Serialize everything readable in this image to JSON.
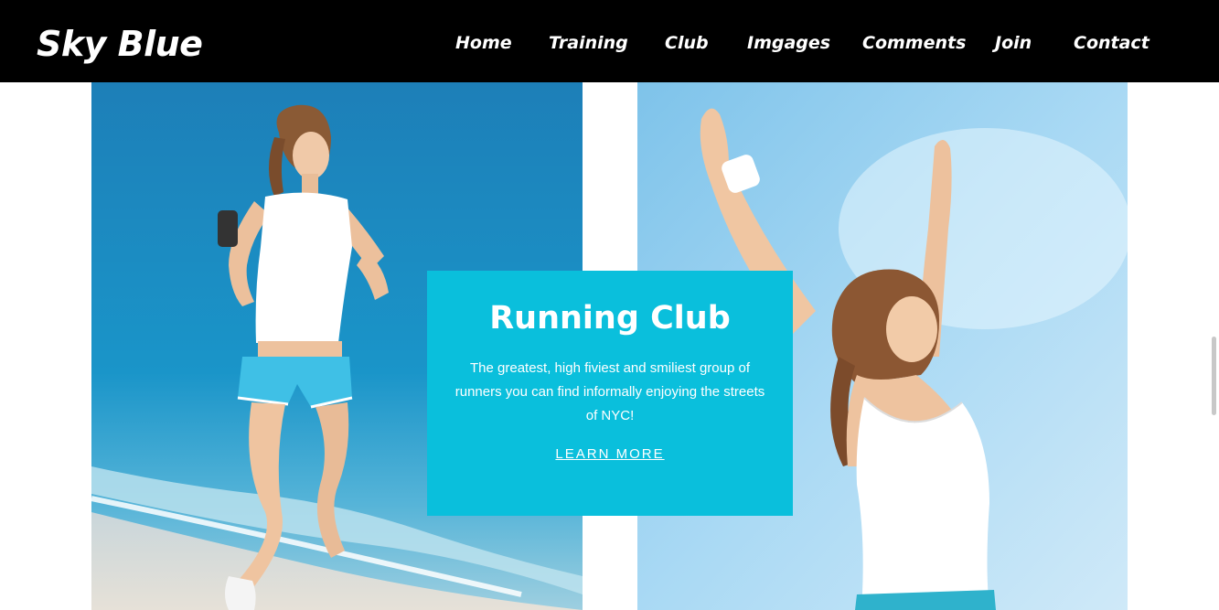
{
  "site": {
    "logo": "Sky Blue"
  },
  "nav": {
    "items": [
      {
        "label": "Home"
      },
      {
        "label": "Training"
      },
      {
        "label": "Club"
      },
      {
        "label": "Imgages"
      },
      {
        "label": "Comments"
      },
      {
        "label": "Join"
      },
      {
        "label": "Contact"
      }
    ]
  },
  "photos": {
    "left": {
      "subject": "woman-running-on-beach"
    },
    "right": {
      "subject": "woman-arms-raised-sky"
    }
  },
  "card": {
    "title": "Running Club",
    "description": "The greatest, high fiviest and smiliest group of runners you can find informally enjoying the streets of NYC!",
    "link": "LEARN MORE"
  },
  "colors": {
    "header_bg": "#000000",
    "card_bg": "#0abfdc",
    "text_light": "#ffffff"
  }
}
